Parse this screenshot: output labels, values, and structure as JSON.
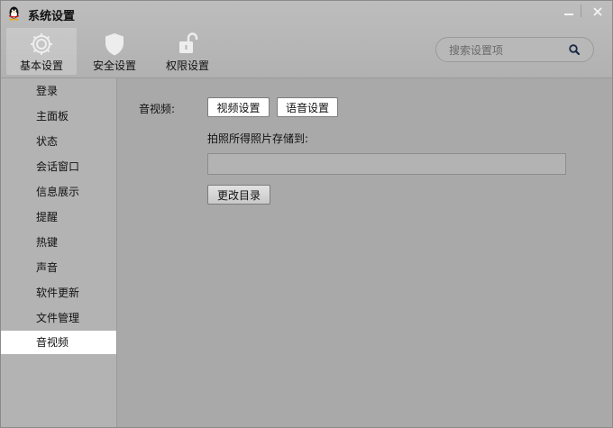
{
  "window": {
    "title": "系统设置",
    "min_label": "最小化",
    "close_label": "关闭"
  },
  "toolbar": {
    "tabs": [
      {
        "label": "基本设置",
        "icon": "gear-icon",
        "active": true
      },
      {
        "label": "安全设置",
        "icon": "shield-icon",
        "active": false
      },
      {
        "label": "权限设置",
        "icon": "unlock-icon",
        "active": false
      }
    ]
  },
  "search": {
    "placeholder": "搜索设置项",
    "value": ""
  },
  "sidebar": {
    "items": [
      {
        "label": "登录",
        "active": false
      },
      {
        "label": "主面板",
        "active": false
      },
      {
        "label": "状态",
        "active": false
      },
      {
        "label": "会话窗口",
        "active": false
      },
      {
        "label": "信息展示",
        "active": false
      },
      {
        "label": "提醒",
        "active": false
      },
      {
        "label": "热键",
        "active": false
      },
      {
        "label": "声音",
        "active": false
      },
      {
        "label": "软件更新",
        "active": false
      },
      {
        "label": "文件管理",
        "active": false
      },
      {
        "label": "音视频",
        "active": true
      }
    ]
  },
  "content": {
    "section_label": "音视频:",
    "video_settings_button": "视频设置",
    "voice_settings_button": "语音设置",
    "photo_storage_label": "拍照所得照片存储到:",
    "photo_path_value": "",
    "change_dir_button": "更改目录"
  },
  "colors": {
    "window_bg": "#a8a8a8",
    "sidebar_bg": "#b3b3b3",
    "active_item_bg": "#ffffff",
    "header_bg": "#b8b8b8"
  }
}
